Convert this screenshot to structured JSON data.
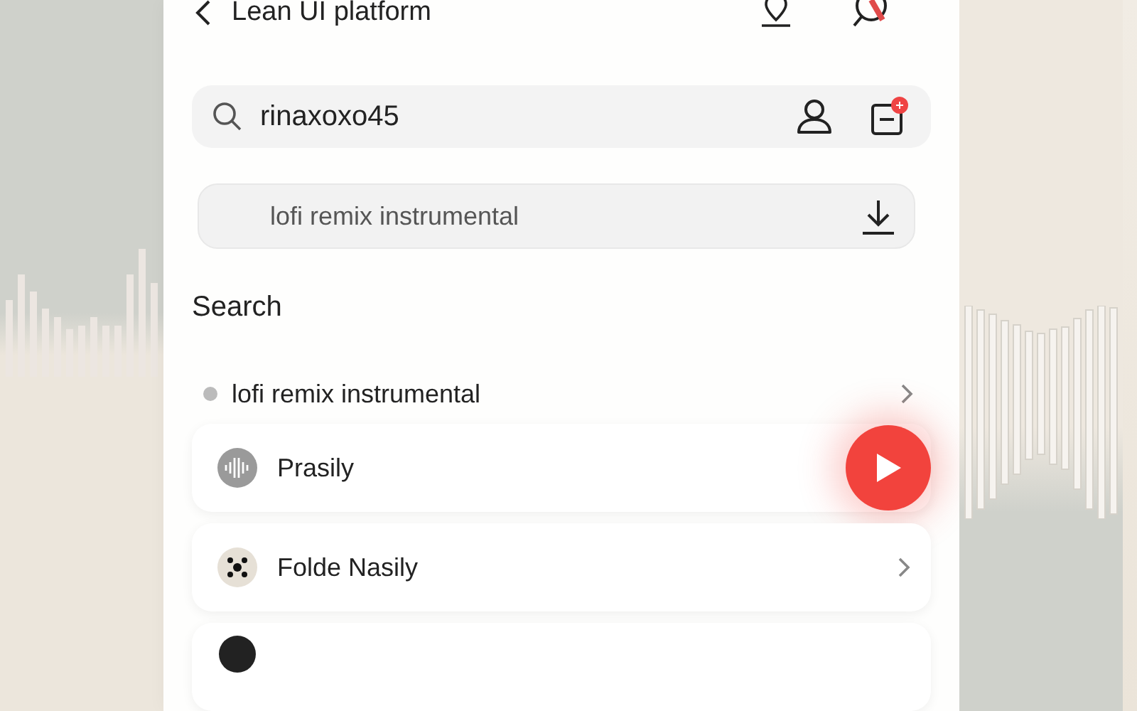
{
  "header": {
    "title": "Lean UI platform"
  },
  "account_search": {
    "value": "rinaxoxo45"
  },
  "query_field": {
    "value": "lofi remix instrumental"
  },
  "section_title": "Search",
  "history": [
    {
      "text": "lofi remix instrumental"
    }
  ],
  "results": [
    {
      "name": "Prasily",
      "kind": "waveform",
      "playable": true
    },
    {
      "name": "Folde Nasily",
      "kind": "dots",
      "playable": false
    }
  ]
}
